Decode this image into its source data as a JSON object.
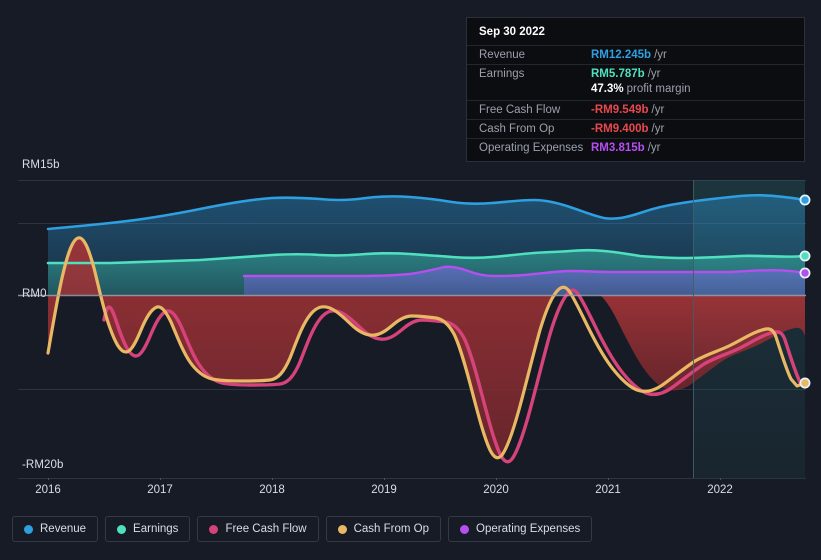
{
  "colors": {
    "background": "#161b26",
    "revenue": "#2e9fe0",
    "earnings": "#4fe0c0",
    "free_cash_flow": "#d6437a",
    "cash_from_op": "#e8b865",
    "operating_expenses": "#b44ff0",
    "negative_fill": "#8e2f34",
    "grid": "#2c3342",
    "zero_line": "#9aa0ad",
    "text": "#d9dde5",
    "muted_text": "#9aa0ad",
    "tooltip_bg": "#0c0d10",
    "tooltip_value_red": "#e8484d",
    "tooltip_value_white": "#ffffff"
  },
  "tooltip": {
    "date": "Sep 30 2022",
    "rows": [
      {
        "name": "Revenue",
        "value": "RM12.245b",
        "unit": "/yr",
        "color": "#2e9fe0",
        "sub": false
      },
      {
        "name": "Earnings",
        "value": "RM5.787b",
        "unit": "/yr",
        "color": "#4fe0c0",
        "sub": false
      },
      {
        "name": "",
        "value": "47.3%",
        "unit": "profit margin",
        "color": "#ffffff",
        "sub": true
      },
      {
        "name": "Free Cash Flow",
        "value": "-RM9.549b",
        "unit": "/yr",
        "color": "#e8484d",
        "sub": false
      },
      {
        "name": "Cash From Op",
        "value": "-RM9.400b",
        "unit": "/yr",
        "color": "#e8484d",
        "sub": false
      },
      {
        "name": "Operating Expenses",
        "value": "RM3.815b",
        "unit": "/yr",
        "color": "#b44ff0",
        "sub": false
      }
    ]
  },
  "legend": {
    "items": [
      {
        "label": "Revenue",
        "color": "#2e9fe0"
      },
      {
        "label": "Earnings",
        "color": "#4fe0c0"
      },
      {
        "label": "Free Cash Flow",
        "color": "#d6437a"
      },
      {
        "label": "Cash From Op",
        "color": "#e8b865"
      },
      {
        "label": "Operating Expenses",
        "color": "#b44ff0"
      }
    ]
  },
  "chart_data": {
    "type": "area",
    "title": "",
    "xlabel": "",
    "ylabel": "",
    "currency": "RM",
    "units": "billions per year",
    "xlim": [
      2015.85,
      2022.95
    ],
    "ylim": [
      -20,
      15
    ],
    "y_ticks": [
      15,
      0,
      -20
    ],
    "y_tick_labels": [
      "RM15b",
      "RM0",
      "-RM20b"
    ],
    "gridlines": [
      15,
      9.4,
      0,
      -12.2,
      -20
    ],
    "x_ticks": [
      2016,
      2017,
      2018,
      2019,
      2020,
      2021,
      2022
    ],
    "x_tick_labels": [
      "2016",
      "2017",
      "2018",
      "2019",
      "2020",
      "2021",
      "2022"
    ],
    "grid": true,
    "legend_position": "bottom",
    "highlight_band": {
      "from": 2021.75,
      "to": 2022.95,
      "label": "forecast-region"
    },
    "series": [
      {
        "name": "Revenue",
        "color": "#2e9fe0",
        "filled": true,
        "end_value": 12.245,
        "x": [
          2016.0,
          2016.25,
          2016.5,
          2016.75,
          2017.0,
          2017.25,
          2017.5,
          2017.75,
          2018.0,
          2018.25,
          2018.5,
          2018.75,
          2019.0,
          2019.25,
          2019.5,
          2019.75,
          2020.0,
          2020.25,
          2020.5,
          2020.75,
          2021.0,
          2021.25,
          2021.5,
          2021.75,
          2022.0,
          2022.25,
          2022.5,
          2022.75
        ],
        "values": [
          8.55,
          8.7,
          8.85,
          9.0,
          9.2,
          9.45,
          9.7,
          9.95,
          10.25,
          10.5,
          10.55,
          10.5,
          10.6,
          10.7,
          10.65,
          10.55,
          10.5,
          10.55,
          10.6,
          10.45,
          10.2,
          10.45,
          10.75,
          11.0,
          11.3,
          11.6,
          11.95,
          12.245
        ]
      },
      {
        "name": "Earnings",
        "color": "#4fe0c0",
        "filled": true,
        "end_value": 5.787,
        "x": [
          2016.0,
          2016.25,
          2016.5,
          2016.75,
          2017.0,
          2017.25,
          2017.5,
          2017.75,
          2018.0,
          2018.25,
          2018.5,
          2018.75,
          2019.0,
          2019.25,
          2019.5,
          2019.75,
          2020.0,
          2020.25,
          2020.5,
          2020.75,
          2021.0,
          2021.25,
          2021.5,
          2021.75,
          2022.0,
          2022.25,
          2022.5,
          2022.75
        ],
        "values": [
          4.5,
          4.5,
          4.5,
          4.55,
          4.6,
          4.65,
          4.7,
          4.8,
          4.9,
          5.0,
          5.05,
          5.0,
          5.05,
          5.1,
          5.05,
          5.0,
          4.95,
          5.2,
          5.4,
          5.25,
          5.05,
          5.1,
          5.15,
          5.25,
          5.4,
          5.55,
          5.7,
          5.787
        ]
      },
      {
        "name": "Operating Expenses",
        "color": "#b44ff0",
        "filled": true,
        "starts_at": 2017.75,
        "end_value": 3.815,
        "x": [
          2017.75,
          2018.0,
          2018.25,
          2018.5,
          2018.75,
          2019.0,
          2019.25,
          2019.5,
          2019.75,
          2020.0,
          2020.25,
          2020.5,
          2020.75,
          2021.0,
          2021.25,
          2021.5,
          2021.75,
          2022.0,
          2022.25,
          2022.5,
          2022.75
        ],
        "values": [
          2.5,
          2.5,
          2.5,
          2.5,
          2.5,
          2.55,
          2.6,
          3.15,
          2.65,
          2.6,
          2.6,
          2.9,
          2.95,
          2.9,
          2.9,
          2.9,
          2.95,
          3.0,
          3.1,
          3.4,
          3.815
        ]
      },
      {
        "name": "Cash From Op",
        "color": "#e8b865",
        "filled": false,
        "end_value": -9.4,
        "x": [
          2016.0,
          2016.1,
          2016.2,
          2016.3,
          2016.4,
          2016.5,
          2016.6,
          2016.7,
          2016.8,
          2016.95,
          2017.1,
          2017.3,
          2017.5,
          2017.7,
          2017.9,
          2018.05,
          2018.2,
          2018.35,
          2018.5,
          2018.65,
          2018.85,
          2019.0,
          2019.2,
          2019.35,
          2019.5,
          2019.65,
          2019.8,
          2019.95,
          2020.1,
          2020.3,
          2020.5,
          2020.65,
          2020.8,
          2020.95,
          2021.1,
          2021.3,
          2021.5,
          2021.7,
          2021.9,
          2022.1,
          2022.3,
          2022.5,
          2022.65,
          2022.8
        ],
        "values": [
          -7.6,
          -3.0,
          2.3,
          5.5,
          4.2,
          0.0,
          -4.3,
          -6.3,
          -5.0,
          -1.0,
          -4.0,
          -10.5,
          -12.4,
          -12.6,
          -12.5,
          -10.5,
          -4.0,
          -2.3,
          -5.6,
          -8.4,
          -5.3,
          -3.6,
          -3.6,
          -3.6,
          -8.0,
          -14.5,
          -20.5,
          -16.0,
          -6.0,
          -0.3,
          -0.2,
          3.5,
          0.2,
          -4.0,
          -7.6,
          -10.8,
          -12.6,
          -11.3,
          -9.0,
          -8.0,
          -8.7,
          -6.0,
          -4.3,
          -9.4
        ]
      },
      {
        "name": "Free Cash Flow",
        "color": "#d6437a",
        "filled": false,
        "end_value": -9.549,
        "note": "tracks just below Cash From Op for most of the range",
        "x": [
          2016.6,
          2016.8,
          2016.95,
          2017.1,
          2017.3,
          2017.5,
          2017.7,
          2017.9,
          2018.05,
          2018.2,
          2018.35,
          2018.5,
          2018.65,
          2018.85,
          2019.0,
          2019.2,
          2019.35,
          2019.5,
          2019.65,
          2019.8,
          2019.95,
          2020.1,
          2020.3,
          2020.5,
          2020.65,
          2020.8,
          2020.95,
          2021.1,
          2021.3,
          2021.5,
          2021.7,
          2021.9,
          2022.1,
          2022.3,
          2022.5,
          2022.65,
          2022.8
        ],
        "values": [
          -4.5,
          -5.2,
          -1.1,
          -4.3,
          -11.0,
          -12.9,
          -13.1,
          -13.0,
          -10.9,
          -4.3,
          -2.6,
          -5.9,
          -8.7,
          -5.6,
          -3.9,
          -3.9,
          -3.9,
          -8.3,
          -14.9,
          -20.9,
          -16.4,
          -6.3,
          -0.6,
          -0.5,
          3.2,
          -0.1,
          -4.3,
          -7.9,
          -11.1,
          -12.9,
          -11.6,
          -9.3,
          -8.3,
          -9.0,
          -6.3,
          -4.6,
          -9.549
        ]
      }
    ]
  }
}
